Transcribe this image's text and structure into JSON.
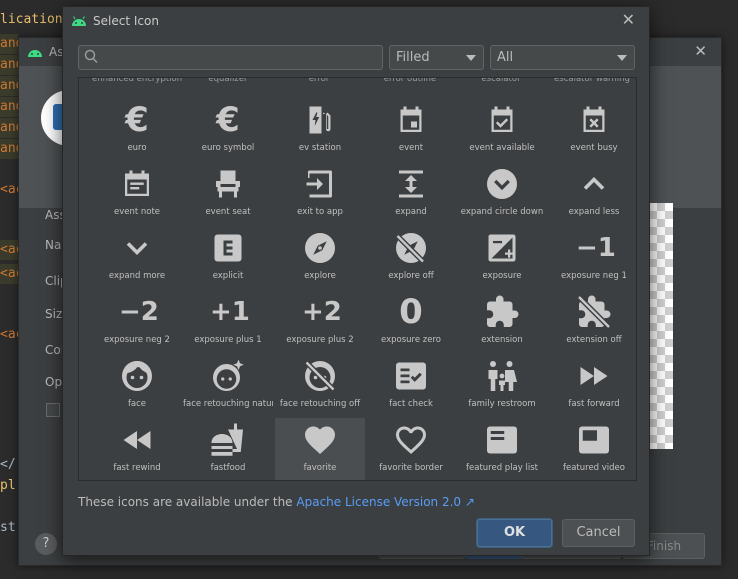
{
  "editor": {
    "lines": [
      {
        "text": "lication",
        "cls": "yel"
      },
      {
        "text": "and",
        "cls": "hl"
      },
      {
        "text": "and",
        "cls": "hl"
      },
      {
        "text": "and",
        "cls": "hl"
      },
      {
        "text": "and",
        "cls": "hl"
      },
      {
        "text": "and",
        "cls": "hl"
      },
      {
        "text": "and",
        "cls": "hl"
      },
      {
        "text": "<ac",
        "cls": ""
      },
      {
        "text": "<ac",
        "cls": "hl"
      },
      {
        "text": "<ac",
        "cls": "hl"
      },
      {
        "text": "<ac",
        "cls": ""
      },
      {
        "text": "</",
        "cls": "white"
      },
      {
        "text": "pl",
        "cls": "yel"
      },
      {
        "text": "st",
        "cls": "white"
      }
    ]
  },
  "wizard": {
    "title": "As",
    "close": "✕",
    "labels": [
      "Ass",
      "Nar",
      "Clip",
      "Size",
      "Col",
      "Opa"
    ],
    "finish": "Finish",
    "help": "?"
  },
  "dialog": {
    "title": "Select Icon",
    "close": "✕",
    "search": {
      "placeholder": "",
      "value": ""
    },
    "style_select": {
      "value": "Filled"
    },
    "category_select": {
      "value": "All"
    },
    "partial_labels": [
      "enhanced encryption",
      "equalizer",
      "error",
      "error outline",
      "escalator",
      "escalator warning"
    ],
    "icons": [
      {
        "name": "euro-icon",
        "label": "euro",
        "glyph": "€"
      },
      {
        "name": "euro-symbol-icon",
        "label": "euro symbol",
        "glyph": "€"
      },
      {
        "name": "ev-station-icon",
        "label": "ev station",
        "glyph": "svg:ev"
      },
      {
        "name": "event-icon",
        "label": "event",
        "glyph": "svg:event"
      },
      {
        "name": "event-available-icon",
        "label": "event available",
        "glyph": "svg:event-available"
      },
      {
        "name": "event-busy-icon",
        "label": "event busy",
        "glyph": "svg:event-busy"
      },
      {
        "name": "event-note-icon",
        "label": "event note",
        "glyph": "svg:event-note"
      },
      {
        "name": "event-seat-icon",
        "label": "event seat",
        "glyph": "svg:seat"
      },
      {
        "name": "exit-to-app-icon",
        "label": "exit to app",
        "glyph": "svg:exit"
      },
      {
        "name": "expand-icon",
        "label": "expand",
        "glyph": "svg:expand"
      },
      {
        "name": "expand-circle-down-icon",
        "label": "expand circle down",
        "glyph": "svg:circle-down"
      },
      {
        "name": "expand-less-icon",
        "label": "expand less",
        "glyph": "svg:chev-up"
      },
      {
        "name": "expand-more-icon",
        "label": "expand more",
        "glyph": "svg:chev-down"
      },
      {
        "name": "explicit-icon",
        "label": "explicit",
        "glyph": "svg:explicit"
      },
      {
        "name": "explore-icon",
        "label": "explore",
        "glyph": "svg:explore"
      },
      {
        "name": "explore-off-icon",
        "label": "explore off",
        "glyph": "svg:explore-off"
      },
      {
        "name": "exposure-icon",
        "label": "exposure",
        "glyph": "svg:exposure"
      },
      {
        "name": "exposure-neg-1-icon",
        "label": "exposure neg 1",
        "glyph": "−1"
      },
      {
        "name": "exposure-neg-2-icon",
        "label": "exposure neg 2",
        "glyph": "−2"
      },
      {
        "name": "exposure-plus-1-icon",
        "label": "exposure plus 1",
        "glyph": "+1"
      },
      {
        "name": "exposure-plus-2-icon",
        "label": "exposure plus 2",
        "glyph": "+2"
      },
      {
        "name": "exposure-zero-icon",
        "label": "exposure zero",
        "glyph": "0"
      },
      {
        "name": "extension-icon",
        "label": "extension",
        "glyph": "svg:extension"
      },
      {
        "name": "extension-off-icon",
        "label": "extension off",
        "glyph": "svg:extension-off"
      },
      {
        "name": "face-icon",
        "label": "face",
        "glyph": "svg:face"
      },
      {
        "name": "face-retouching-natural-icon",
        "label": "face retouching natural",
        "glyph": "svg:face-natural"
      },
      {
        "name": "face-retouching-off-icon",
        "label": "face retouching off",
        "glyph": "svg:face-off"
      },
      {
        "name": "fact-check-icon",
        "label": "fact check",
        "glyph": "svg:fact-check"
      },
      {
        "name": "family-restroom-icon",
        "label": "family restroom",
        "glyph": "svg:family"
      },
      {
        "name": "fast-forward-icon",
        "label": "fast forward",
        "glyph": "svg:ff"
      },
      {
        "name": "fast-rewind-icon",
        "label": "fast rewind",
        "glyph": "svg:rw"
      },
      {
        "name": "fastfood-icon",
        "label": "fastfood",
        "glyph": "svg:fastfood"
      },
      {
        "name": "favorite-icon",
        "label": "favorite",
        "glyph": "svg:heart"
      },
      {
        "name": "favorite-border-icon",
        "label": "favorite border",
        "glyph": "svg:heart-border"
      },
      {
        "name": "featured-play-list-icon",
        "label": "featured play list",
        "glyph": "svg:fpl"
      },
      {
        "name": "featured-video-icon",
        "label": "featured video",
        "glyph": "svg:fvideo"
      }
    ],
    "selected_label": "favorite",
    "license_text": "These icons are available under the ",
    "license_link": "Apache License Version 2.0 ↗",
    "ok": "OK",
    "cancel": "Cancel"
  },
  "colors": {
    "accent": "#365880",
    "link": "#589df6",
    "android_green": "#3ddc84"
  }
}
